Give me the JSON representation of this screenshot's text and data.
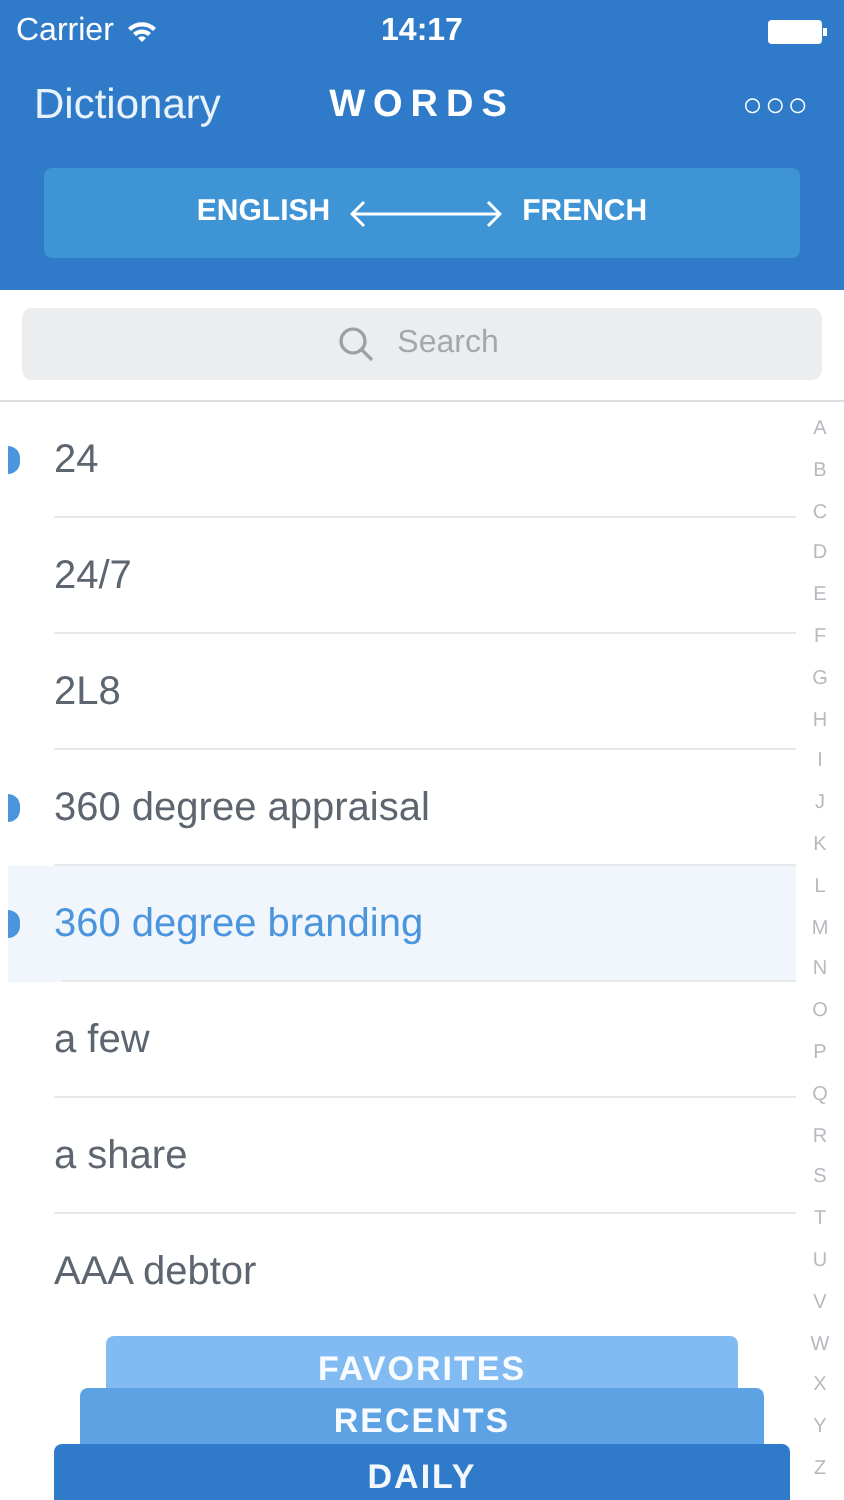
{
  "status_bar": {
    "carrier": "Carrier",
    "time": "14:17"
  },
  "nav": {
    "back": "Dictionary",
    "title": "WORDS",
    "more": "○○○"
  },
  "language_switch": {
    "from": "ENGLISH",
    "to": "FRENCH"
  },
  "search": {
    "placeholder": "Search"
  },
  "words": [
    {
      "text": "24",
      "marked": true,
      "selected": false
    },
    {
      "text": "24/7",
      "marked": false,
      "selected": false
    },
    {
      "text": "2L8",
      "marked": false,
      "selected": false
    },
    {
      "text": "360 degree appraisal",
      "marked": true,
      "selected": false
    },
    {
      "text": "360 degree branding",
      "marked": true,
      "selected": true
    },
    {
      "text": "a few",
      "marked": false,
      "selected": false
    },
    {
      "text": "a share",
      "marked": false,
      "selected": false
    },
    {
      "text": "AAA debtor",
      "marked": false,
      "selected": false
    }
  ],
  "index": [
    "A",
    "B",
    "C",
    "D",
    "E",
    "F",
    "G",
    "H",
    "I",
    "J",
    "K",
    "L",
    "M",
    "N",
    "O",
    "P",
    "Q",
    "R",
    "S",
    "T",
    "U",
    "V",
    "W",
    "X",
    "Y",
    "Z"
  ],
  "bottom_tabs": [
    {
      "label": "FAVORITES",
      "kind": "back"
    },
    {
      "label": "RECENTS",
      "kind": "middle"
    },
    {
      "label": "DAILY",
      "kind": "front"
    }
  ]
}
